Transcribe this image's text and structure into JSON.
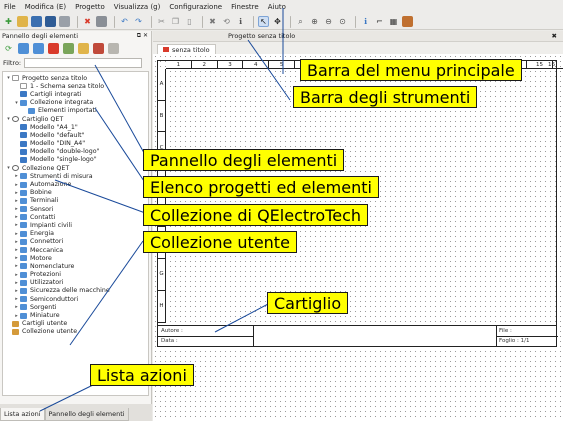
{
  "menu": [
    "File",
    "Modifica (E)",
    "Progetto",
    "Visualizza (g)",
    "Configurazione",
    "Finestre",
    "Aiuto"
  ],
  "dock": {
    "title": "Pannello degli elementi",
    "filter_label": "Filtro:",
    "filter_value": ""
  },
  "tree": [
    {
      "indent": 0,
      "arrow": "▾",
      "icon": "doc",
      "label": "Progetto senza titolo"
    },
    {
      "indent": 1,
      "arrow": "",
      "icon": "doc",
      "label": "1 - Schema senza titolo"
    },
    {
      "indent": 1,
      "arrow": "",
      "icon": "cart",
      "label": "Cartigli integrati"
    },
    {
      "indent": 1,
      "arrow": "▾",
      "icon": "folder",
      "label": "Collezione integrata"
    },
    {
      "indent": 2,
      "arrow": "",
      "icon": "folder",
      "label": "Elementi importati"
    },
    {
      "indent": 0,
      "arrow": "▾",
      "icon": "qet",
      "label": "Cartiglio QET"
    },
    {
      "indent": 1,
      "arrow": "",
      "icon": "cart",
      "label": "Modello \"A4_1\""
    },
    {
      "indent": 1,
      "arrow": "",
      "icon": "cart",
      "label": "Modello \"default\""
    },
    {
      "indent": 1,
      "arrow": "",
      "icon": "cart",
      "label": "Modello \"DIN_A4\""
    },
    {
      "indent": 1,
      "arrow": "",
      "icon": "cart",
      "label": "Modello \"double-logo\""
    },
    {
      "indent": 1,
      "arrow": "",
      "icon": "cart",
      "label": "Modello \"single-logo\""
    },
    {
      "indent": 0,
      "arrow": "▾",
      "icon": "qet",
      "label": "Collezione QET"
    },
    {
      "indent": 1,
      "arrow": "▸",
      "icon": "folder",
      "label": "Strumenti di misura"
    },
    {
      "indent": 1,
      "arrow": "▸",
      "icon": "folder",
      "label": "Automazione"
    },
    {
      "indent": 1,
      "arrow": "▸",
      "icon": "folder",
      "label": "Bobine"
    },
    {
      "indent": 1,
      "arrow": "▸",
      "icon": "folder",
      "label": "Terminali"
    },
    {
      "indent": 1,
      "arrow": "▸",
      "icon": "folder",
      "label": "Sensori"
    },
    {
      "indent": 1,
      "arrow": "▸",
      "icon": "folder",
      "label": "Contatti"
    },
    {
      "indent": 1,
      "arrow": "▸",
      "icon": "folder",
      "label": "Impianti civili"
    },
    {
      "indent": 1,
      "arrow": "▸",
      "icon": "folder",
      "label": "Energia"
    },
    {
      "indent": 1,
      "arrow": "▸",
      "icon": "folder",
      "label": "Connettori"
    },
    {
      "indent": 1,
      "arrow": "▸",
      "icon": "folder",
      "label": "Meccanica"
    },
    {
      "indent": 1,
      "arrow": "▸",
      "icon": "folder",
      "label": "Motore"
    },
    {
      "indent": 1,
      "arrow": "▸",
      "icon": "folder",
      "label": "Nomenclature"
    },
    {
      "indent": 1,
      "arrow": "▸",
      "icon": "folder",
      "label": "Protezioni"
    },
    {
      "indent": 1,
      "arrow": "▸",
      "icon": "folder",
      "label": "Utilizzatori"
    },
    {
      "indent": 1,
      "arrow": "▸",
      "icon": "folder",
      "label": "Sicurezza delle macchine"
    },
    {
      "indent": 1,
      "arrow": "▸",
      "icon": "folder",
      "label": "Semiconduttori"
    },
    {
      "indent": 1,
      "arrow": "▸",
      "icon": "folder",
      "label": "Sorgenti"
    },
    {
      "indent": 1,
      "arrow": "▸",
      "icon": "folder",
      "label": "Miniature"
    },
    {
      "indent": 0,
      "arrow": "",
      "icon": "home",
      "label": "Cartigli utente"
    },
    {
      "indent": 0,
      "arrow": "",
      "icon": "home",
      "label": "Collezione utente"
    }
  ],
  "bottom_tabs": [
    "Lista azioni",
    "Pannello degli elementi"
  ],
  "workspace": {
    "window_title": "Progetto senza titolo",
    "tab_label": "senza titolo",
    "columns": [
      "1",
      "2",
      "3",
      "4",
      "5",
      "6",
      "7",
      "8",
      "9",
      "10",
      "11",
      "12",
      "13",
      "14",
      "15"
    ],
    "last_column": "16",
    "rows": [
      "A",
      "B",
      "C",
      "D",
      "E",
      "F",
      "G",
      "H"
    ],
    "cartouche": {
      "author": "Autore :",
      "date": "Data :",
      "file": "File :",
      "sheet": "Foglio : 1/1"
    }
  },
  "callouts": {
    "menu_bar": "Barra del menu principale",
    "toolbar": "Barra degli strumenti",
    "elements_panel": "Pannello degli elementi",
    "project_list": "Elenco progetti ed elementi",
    "qet_collection": "Collezione di QElectroTech",
    "user_collection": "Collezione utente",
    "cartouche": "Cartiglio",
    "action_list": "Lista azioni"
  },
  "colors": {
    "callout_bg": "#ffff00",
    "folder_icon": "#4f8fd6",
    "tab_marker": "#d93b2b"
  }
}
